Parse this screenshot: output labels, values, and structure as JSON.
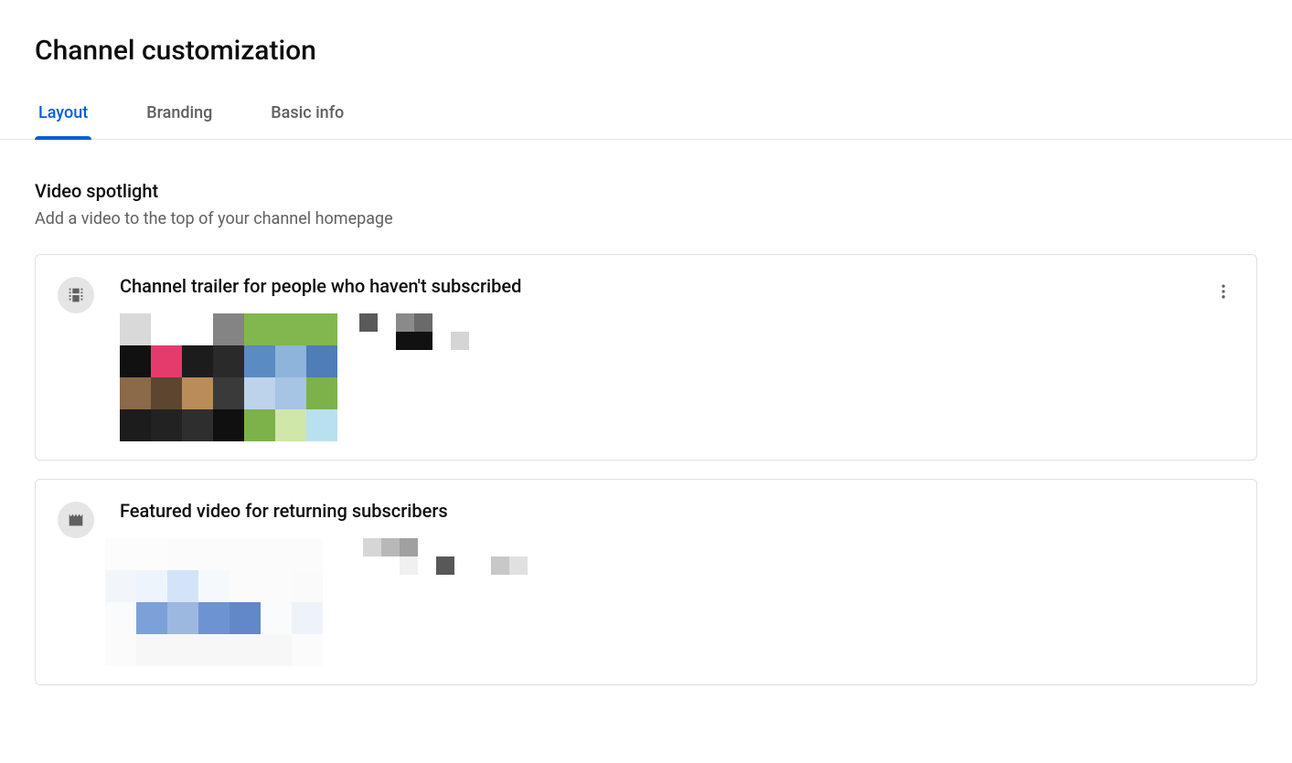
{
  "page": {
    "title": "Channel customization"
  },
  "tabs": {
    "layout": "Layout",
    "branding": "Branding",
    "basic_info": "Basic info"
  },
  "spotlight": {
    "title": "Video spotlight",
    "subtitle": "Add a video to the top of your channel homepage"
  },
  "cards": {
    "trailer": {
      "title": "Channel trailer for people who haven't subscribed"
    },
    "featured": {
      "title": "Featured video for returning subscribers"
    }
  }
}
